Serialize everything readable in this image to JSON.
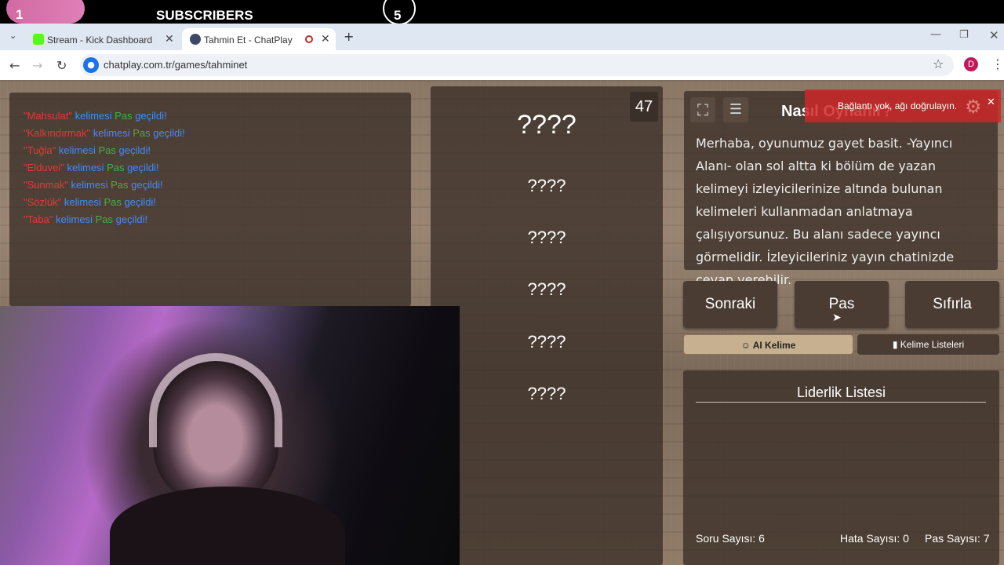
{
  "overlay": {
    "left_count": "1",
    "title": "SUBSCRIBERS",
    "right_count": "5"
  },
  "browser": {
    "tabs": [
      {
        "title": "Stream - Kick Dashboard",
        "active": false
      },
      {
        "title": "Tahmin Et - ChatPlay",
        "active": true
      }
    ],
    "url": "chatplay.com.tr/games/tahminet",
    "profile_initial": "D"
  },
  "chat_log": [
    {
      "word": "\"Mahsulat\"",
      "mid": " kelimesi ",
      "pas": "Pas",
      "end": " geçildi!"
    },
    {
      "word": "\"Kalkındırmak\"",
      "mid": " kelimesi ",
      "pas": "Pas",
      "end": " geçildi!"
    },
    {
      "word": "\"Tuğla\"",
      "mid": " kelimesi ",
      "pas": "Pas",
      "end": " geçildi!"
    },
    {
      "word": "\"Elduvei\"",
      "mid": " kelimesi ",
      "pas": "Pas",
      "end": " geçildi!"
    },
    {
      "word": "\"Sunmak\"",
      "mid": " kelimesi ",
      "pas": "Pas",
      "end": " geçildi!"
    },
    {
      "word": "\"Sözlük\"",
      "mid": " kelimesi ",
      "pas": "Pas",
      "end": " geçildi!"
    },
    {
      "word": "\"Taba\"",
      "mid": " kelimesi ",
      "pas": "Pas",
      "end": " geçildi!"
    }
  ],
  "game": {
    "timer": "47",
    "main_word": "????",
    "hidden_words": [
      "????",
      "????",
      "????",
      "????",
      "????"
    ]
  },
  "howto": {
    "title": "Nasıl Oynanır?",
    "text": "Merhaba, oyunumuz gayet basit. -Yayıncı Alanı- olan sol altta ki bölüm de yazan kelimeyi izleyicilerinize altında bulunan kelimeleri kullanmadan anlatmaya çalışıyorsunuz. Bu alanı sadece yayıncı görmelidir. İzleyicileriniz yayın chatinizde cevap verebilir."
  },
  "toast": {
    "text": "Bağlantı yok, ağı doğrulayın."
  },
  "controls": {
    "next": "Sonraki",
    "pass": "Pas",
    "reset": "Sıfırla",
    "ai_word": "AI Kelime",
    "word_lists": "Kelime Listeleri"
  },
  "leaderboard": {
    "title": "Liderlik Listesi"
  },
  "stats": {
    "questions": "Soru Sayısı: 6",
    "errors": "Hata Sayısı: 0",
    "passes": "Pas Sayısı: 7"
  },
  "colors": {
    "word": "#e53935",
    "kelimesi": "#3f8cff",
    "pas": "#43b047"
  }
}
